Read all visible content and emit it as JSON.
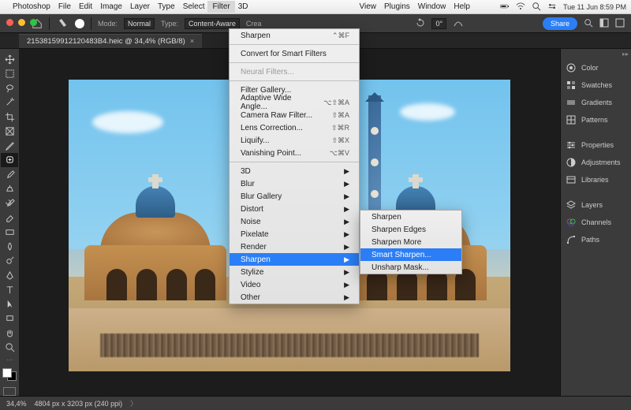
{
  "menubar": {
    "app": "Photoshop",
    "items": [
      "File",
      "Edit",
      "Image",
      "Layer",
      "Type",
      "Select",
      "Filter",
      "3D"
    ],
    "items_right": [
      "View",
      "Plugins",
      "Window",
      "Help"
    ],
    "active": "Filter",
    "clock": "Tue 11 Jun  8:59 PM"
  },
  "options_bar": {
    "mode_label": "Mode:",
    "mode_value": "Normal",
    "type_label": "Type:",
    "type_value": "Content-Aware",
    "create_label": "Crea",
    "rotate_value": "0°",
    "share_label": "Share"
  },
  "document": {
    "tab_title": "21538159912120483B4.heic @ 34,4% (RGB/8)",
    "zoom": "34,4%",
    "dimensions": "4804 px x 3203 px (240 ppi)"
  },
  "filter_menu": {
    "last": {
      "label": "Sharpen",
      "shortcut": "⌃⌘F"
    },
    "convert": "Convert for Smart Filters",
    "neural": "Neural Filters...",
    "grp1": [
      {
        "label": "Filter Gallery...",
        "shortcut": ""
      },
      {
        "label": "Adaptive Wide Angle...",
        "shortcut": "⌥⇧⌘A"
      },
      {
        "label": "Camera Raw Filter...",
        "shortcut": "⇧⌘A"
      },
      {
        "label": "Lens Correction...",
        "shortcut": "⇧⌘R"
      },
      {
        "label": "Liquify...",
        "shortcut": "⇧⌘X"
      },
      {
        "label": "Vanishing Point...",
        "shortcut": "⌥⌘V"
      }
    ],
    "grp2": [
      "3D",
      "Blur",
      "Blur Gallery",
      "Distort",
      "Noise",
      "Pixelate",
      "Render",
      "Sharpen",
      "Stylize",
      "Video",
      "Other"
    ],
    "highlighted": "Sharpen"
  },
  "sharpen_submenu": {
    "items": [
      "Sharpen",
      "Sharpen Edges",
      "Sharpen More",
      "Smart Sharpen...",
      "Unsharp Mask..."
    ],
    "selected": "Smart Sharpen..."
  },
  "right_panels": {
    "grp_a": [
      "Color",
      "Swatches",
      "Gradients",
      "Patterns"
    ],
    "grp_b": [
      "Properties",
      "Adjustments",
      "Libraries"
    ],
    "grp_c": [
      "Layers",
      "Channels",
      "Paths"
    ]
  },
  "tools": [
    "move",
    "marquee",
    "lasso",
    "wand",
    "crop",
    "frame",
    "eyedrop",
    "heal",
    "brush",
    "stamp",
    "history",
    "eraser",
    "gradient",
    "blur",
    "dodge",
    "pen",
    "type",
    "path",
    "rect",
    "hand",
    "zoom"
  ]
}
